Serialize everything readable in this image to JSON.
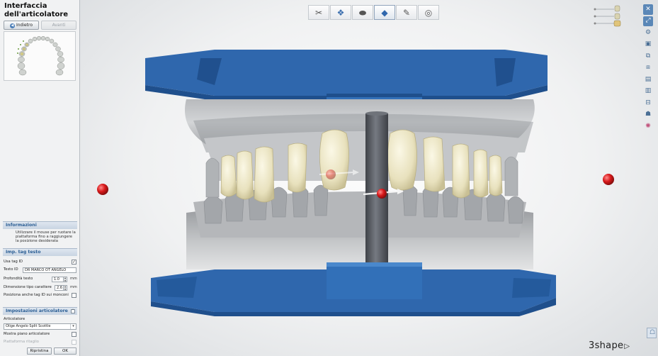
{
  "panel": {
    "title": "Interfaccia dell'articolatore",
    "back_label": "Indietro",
    "next_label": "Avanti",
    "info": {
      "header": "Informazioni",
      "text": "Utilizzare il mouse per ruotare la piattaforma fino a raggiungere la posizione desiderata"
    },
    "tag": {
      "header": "Imp. tag testo",
      "use_tag_label": "Usa tag ID",
      "text_id_label": "Testo ID",
      "text_id_value": "DR MARCO OT ANGELO",
      "depth_label": "Profondità testo",
      "depth_value": "1.0",
      "font_size_label": "Dimensione tipo carattere",
      "font_size_value": "2.6",
      "unit": "mm",
      "position_label": "Posiziona anche tag ID sui monconi"
    },
    "articulator": {
      "header": "Impostazioni articolatore",
      "articulator_label": "Articolatore",
      "articulator_value": "Olige Angelo Split Scottle",
      "show_plane_label": "Mostra piano articolatore",
      "platform_label": "Piattaforma ritaglio"
    },
    "reset_label": "Ripristina",
    "ok_label": "OK"
  },
  "viewport": {
    "top_tools": [
      "scissors-tool-icon",
      "multi-die-icon",
      "model-base-icon",
      "articulator-plate-icon",
      "trim-tool-icon",
      "sphere-view-icon"
    ],
    "active_tool": 3,
    "logo": "3shape"
  },
  "colors": {
    "base_blue": "#2f67ad",
    "gypsum": "#c7c9cc",
    "tooth": "#e9e4c4",
    "pin": "#5c5f66",
    "handle": "#d81e1e",
    "accent": "#4d7fb8"
  }
}
